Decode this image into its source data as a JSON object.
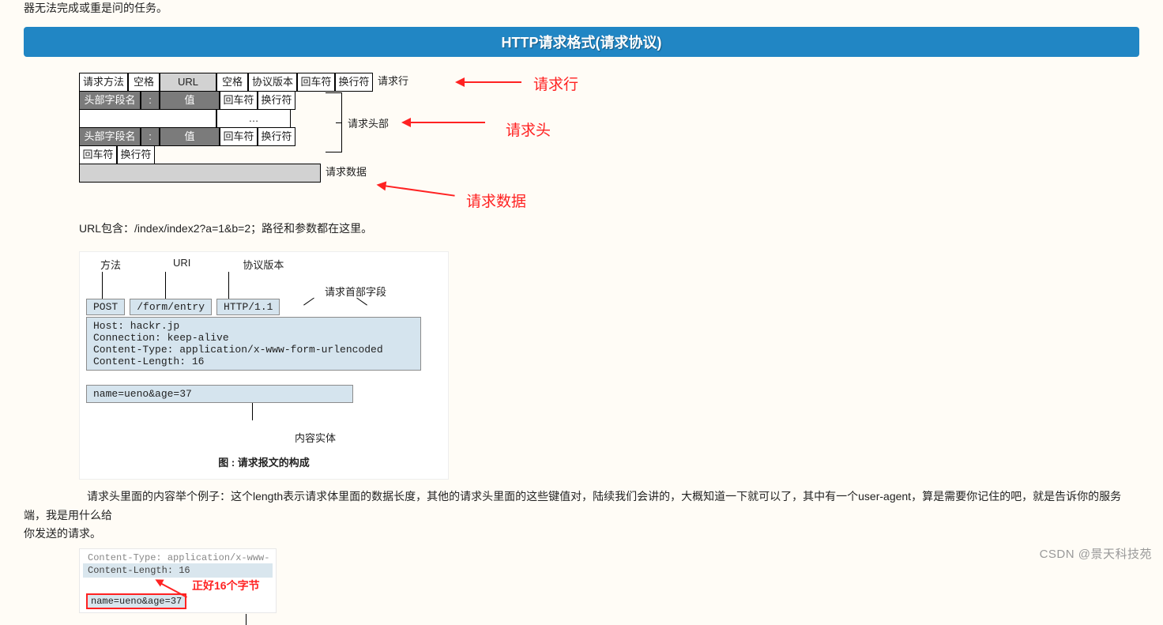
{
  "top_fragment": "器无法完成或重是问的任务。",
  "banner": "HTTP请求格式(请求协议)",
  "req_line": {
    "cells": [
      "请求方法",
      "空格",
      "URL",
      "空格",
      "协议版本",
      "回车符",
      "换行符"
    ],
    "suffix": "请求行"
  },
  "header_row": {
    "cells": [
      "头部字段名",
      ":",
      "值",
      "回车符",
      "换行符"
    ]
  },
  "dots_row": "…",
  "cr_lf_row": {
    "cells": [
      "回车符",
      "换行符"
    ]
  },
  "body_row": {
    "label": "请求数据"
  },
  "bracket_label": "请求头部",
  "annotations": {
    "line": "请求行",
    "header": "请求头",
    "data": "请求数据"
  },
  "url_note": "URL包含：/index/index2?a=1&b=2；路径和参数都在这里。",
  "diagram2": {
    "labels": {
      "method": "方法",
      "uri": "URI",
      "proto": "协议版本",
      "hdrfield": "请求首部字段",
      "body": "内容实体"
    },
    "line1": {
      "method": "POST",
      "uri": "/form/entry",
      "proto": "HTTP/1.1"
    },
    "headers": "Host: hackr.jp\nConnection: keep-alive\nContent-Type: application/x-www-form-urlencoded\nContent-Length: 16",
    "body": "name=ueno&age=37",
    "caption": "图 : 请求报文的构成"
  },
  "para2_a": "请求头里面的内容举个例子：这个length表示请求体里面的数据长度，其他的请求头里面的这些键值对，陆续我们会讲的，大概知道一下就可以了，其中有一个user-agent，算是需要你记住的吧，就是告诉你的服务端，我是用什么给",
  "para2_b": "你发送的请求。",
  "diagram3": {
    "cut_line": "Content-Type: application/x-www-",
    "pre": "Content-Length: 16",
    "body": "name=ueno&age=37",
    "annot": "正好16个字节"
  },
  "watermark": "CSDN @景天科技苑"
}
